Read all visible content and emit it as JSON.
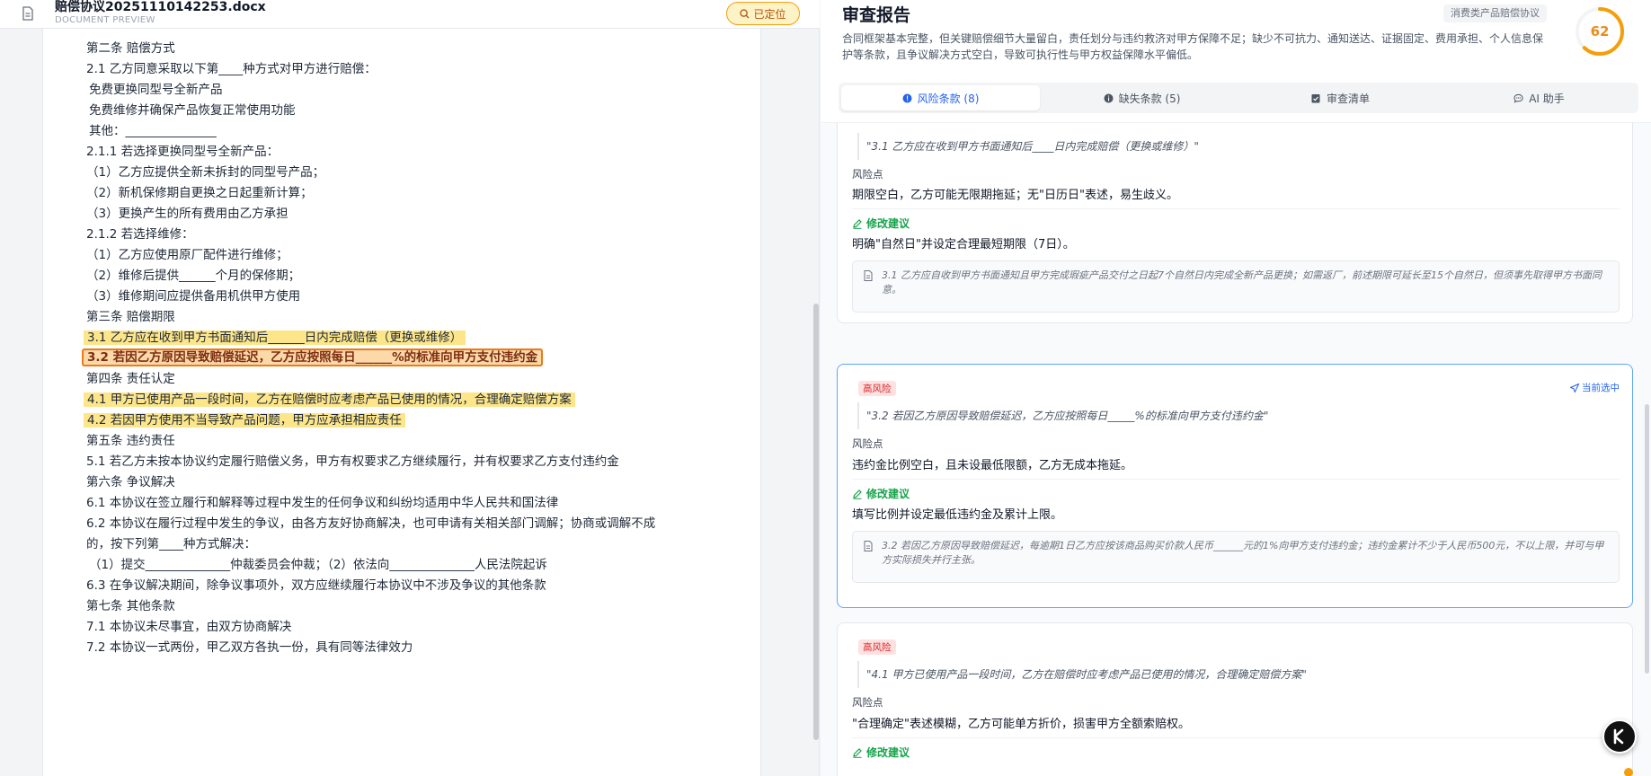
{
  "doc": {
    "filename": "赔偿协议20251110142253.docx",
    "subtitle": "DOCUMENT PREVIEW",
    "locate_label": "已定位"
  },
  "paper": {
    "lines": [
      "第二条 赔偿方式",
      "2.1 乙方同意采取以下第____种方式对甲方进行赔偿：",
      "免费更换同型号全新产品",
      "免费维修并确保产品恢复正常使用功能",
      "其他：_______________",
      "2.1.1 若选择更换同型号全新产品：",
      "（1）乙方应提供全新未拆封的同型号产品；",
      "（2）新机保修期自更换之日起重新计算；",
      "（3）更换产生的所有费用由乙方承担",
      "2.1.2 若选择维修：",
      "（1）乙方应使用原厂配件进行维修；",
      "（2）维修后提供______个月的保修期；",
      "（3）维修期间应提供备用机供甲方使用",
      "第三条 赔偿期限",
      "3.1 乙方应在收到甲方书面通知后______日内完成赔偿（更换或维修）",
      "3.2 若因乙方原因导致赔偿延迟，乙方应按照每日______%的标准向甲方支付违约金",
      "第四条 责任认定",
      "4.1 甲方已使用产品一段时间，乙方在赔偿时应考虑产品已使用的情况，合理确定赔偿方案",
      "4.2 若因甲方使用不当导致产品问题，甲方应承担相应责任",
      "第五条 违约责任",
      "5.1 若乙方未按本协议约定履行赔偿义务，甲方有权要求乙方继续履行，并有权要求乙方支付违约金",
      "第六条 争议解决",
      "6.1 本协议在签立履行和解释等过程中发生的任何争议和纠纷均适用中华人民共和国法律",
      "6.2 本协议在履行过程中发生的争议，由各方友好协商解决，也可申请有关相关部门调解；协商或调解不成",
      "的，按下列第____种方式解决：",
      "（1）提交______________仲裁委员会仲裁；（2）依法向______________人民法院起诉",
      "6.3 在争议解决期间，除争议事项外，双方应继续履行本协议中不涉及争议的其他条款",
      "第七条 其他条款",
      "7.1 本协议未尽事宜，由双方协商解决",
      "7.2 本协议一式两份，甲乙双方各执一份，具有同等法律效力"
    ]
  },
  "report": {
    "title": "审查报告",
    "tag": "消费类产品赔偿协议",
    "summary": "合同框架基本完整，但关键赔偿细节大量留白，责任划分与违约救济对甲方保障不足；缺少不可抗力、通知送达、证据固定、费用承担、个人信息保护等条款，且争议解决方式空白，导致可执行性与甲方权益保障水平偏低。",
    "score": "62",
    "score_fraction": 0.62
  },
  "tabs": [
    {
      "label": "风险条款 (8)",
      "icon": "alert-circle-icon",
      "active": true
    },
    {
      "label": "缺失条款 (5)",
      "icon": "info-icon",
      "active": false
    },
    {
      "label": "审查清单",
      "icon": "clipboard-icon",
      "active": false
    },
    {
      "label": "AI 助手",
      "icon": "chat-icon",
      "active": false
    }
  ],
  "cards": [
    {
      "quote": "\"3.1 乙方应在收到甲方书面通知后____日内完成赔偿（更换或维修）\"",
      "risk_label": "风险点",
      "risk_text": "期限空白，乙方可能无限期拖延；无\"日历日\"表述，易生歧义。",
      "sugg_label": "修改建议",
      "sugg_text": "明确\"自然日\"并设定合理最短期限（7日）。",
      "rewrite": "3.1 乙方应自收到甲方书面通知且甲方完成瑕疵产品交付之日起7个自然日内完成全新产品更换；如需返厂，前述期限可延长至15个自然日，但须事先取得甲方书面同意。"
    },
    {
      "badge": "高风险",
      "current": "当前选中",
      "quote": "\"3.2 若因乙方原因导致赔偿延迟，乙方应按照每日_____%的标准向甲方支付违约金\"",
      "risk_label": "风险点",
      "risk_text": "违约金比例空白，且未设最低限额，乙方无成本拖延。",
      "sugg_label": "修改建议",
      "sugg_text": "填写比例并设定最低违约金及累计上限。",
      "rewrite": "3.2 若因乙方原因导致赔偿延迟，每逾期1日乙方应按该商品购买价款人民币______元的1%向甲方支付违约金；违约金累计不少于人民币500元，不以上限，并可与甲方实际损失并行主张。"
    },
    {
      "badge": "高风险",
      "quote": "\"4.1 甲方已使用产品一段时间，乙方在赔偿时应考虑产品已使用的情况，合理确定赔偿方案\"",
      "risk_label": "风险点",
      "risk_text": "\"合理确定\"表述模糊，乙方可能单方折价，损害甲方全额索赔权。",
      "sugg_label": "修改建议"
    }
  ]
}
